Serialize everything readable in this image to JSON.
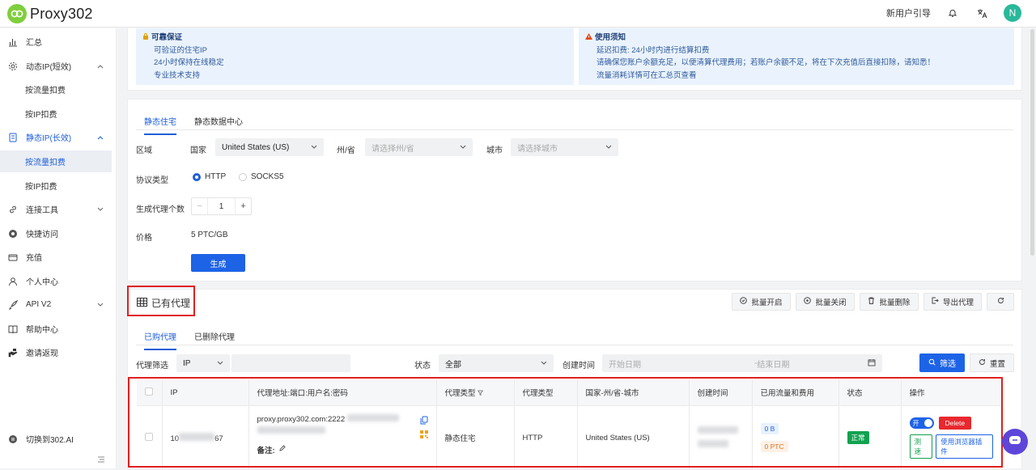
{
  "app": {
    "name": "Proxy302",
    "guide": "新用户引导",
    "avatar_letter": "N",
    "accent": "#1d63e6",
    "logo_color": "#7fcf3c"
  },
  "sidebar": {
    "items": [
      {
        "label": "汇总",
        "icon": "chart-bar-icon"
      },
      {
        "label": "动态IP(短效)",
        "icon": "gear-icon"
      },
      {
        "label": "按流量扣费"
      },
      {
        "label": "按IP扣费"
      },
      {
        "label": "静态IP(长效)",
        "icon": "server-icon"
      },
      {
        "label": "按流量扣费"
      },
      {
        "label": "按IP扣费"
      },
      {
        "label": "连接工具",
        "icon": "link-icon"
      },
      {
        "label": "快捷访问",
        "icon": "chrome-icon"
      },
      {
        "label": "充值",
        "icon": "wallet-icon"
      },
      {
        "label": "个人中心",
        "icon": "user-icon"
      },
      {
        "label": "API V2",
        "icon": "rocket-icon"
      },
      {
        "label": "帮助中心",
        "icon": "book-icon"
      },
      {
        "label": "邀请返现",
        "icon": "hand-icon"
      }
    ],
    "switch": "切换到302.AI"
  },
  "notice_left": {
    "title": "可靠保证",
    "lines": [
      "可验证的住宅IP",
      "24小时保持在线稳定",
      "专业技术支持"
    ]
  },
  "notice_right": {
    "title": "使用须知",
    "lines": [
      "延迟扣费: 24小时内进行结算扣费",
      "请确保您账户余额充足，以便清算代理费用；若账户余额不足，将在下次充值后直接扣除，请知悉！",
      "流量消耗详情可在汇总页查看"
    ]
  },
  "form": {
    "tabs": [
      "静态住宅",
      "静态数据中心"
    ],
    "region_label": "区域",
    "country_label": "国家",
    "country_value": "United States (US)",
    "state_label": "州/省",
    "state_placeholder": "请选择州/省",
    "city_label": "城市",
    "city_placeholder": "请选择城市",
    "protocol_label": "协议类型",
    "protocol_options": [
      "HTTP",
      "SOCKS5"
    ],
    "count_label": "生成代理个数",
    "count_value": "1",
    "price_label": "价格",
    "price_value": "5 PTC/GB",
    "generate": "生成"
  },
  "proxies": {
    "title": "已有代理",
    "actions": [
      "批量开启",
      "批量关闭",
      "批量删除",
      "导出代理"
    ],
    "tabs": [
      "已购代理",
      "已删除代理"
    ],
    "filter_label": "代理筛选",
    "filter_type": "IP",
    "status_label": "状态",
    "status_value": "全部",
    "created_label": "创建时间",
    "start_placeholder": "开始日期",
    "end_placeholder": "结束日期",
    "date_sep": "-",
    "search": "筛选",
    "reset": "重置",
    "columns": [
      "IP",
      "代理地址:端口:用户名:密码",
      "代理类型",
      "代理类型",
      "国家-州/省-城市",
      "创建时间",
      "已用流量和费用",
      "状态",
      "操作"
    ],
    "row": {
      "ip_prefix": "10",
      "ip_suffix": "67",
      "address": "proxy.proxy302.com:2222",
      "note_label": "备注:",
      "kind": "静态住宅",
      "protocol": "HTTP",
      "location": "United States (US)",
      "traffic": "0 B",
      "cost": "0 PTC",
      "status": "正常",
      "toggle": "开",
      "delete": "Delete",
      "test": "测速",
      "plugin": "使用浏览器插件"
    }
  }
}
